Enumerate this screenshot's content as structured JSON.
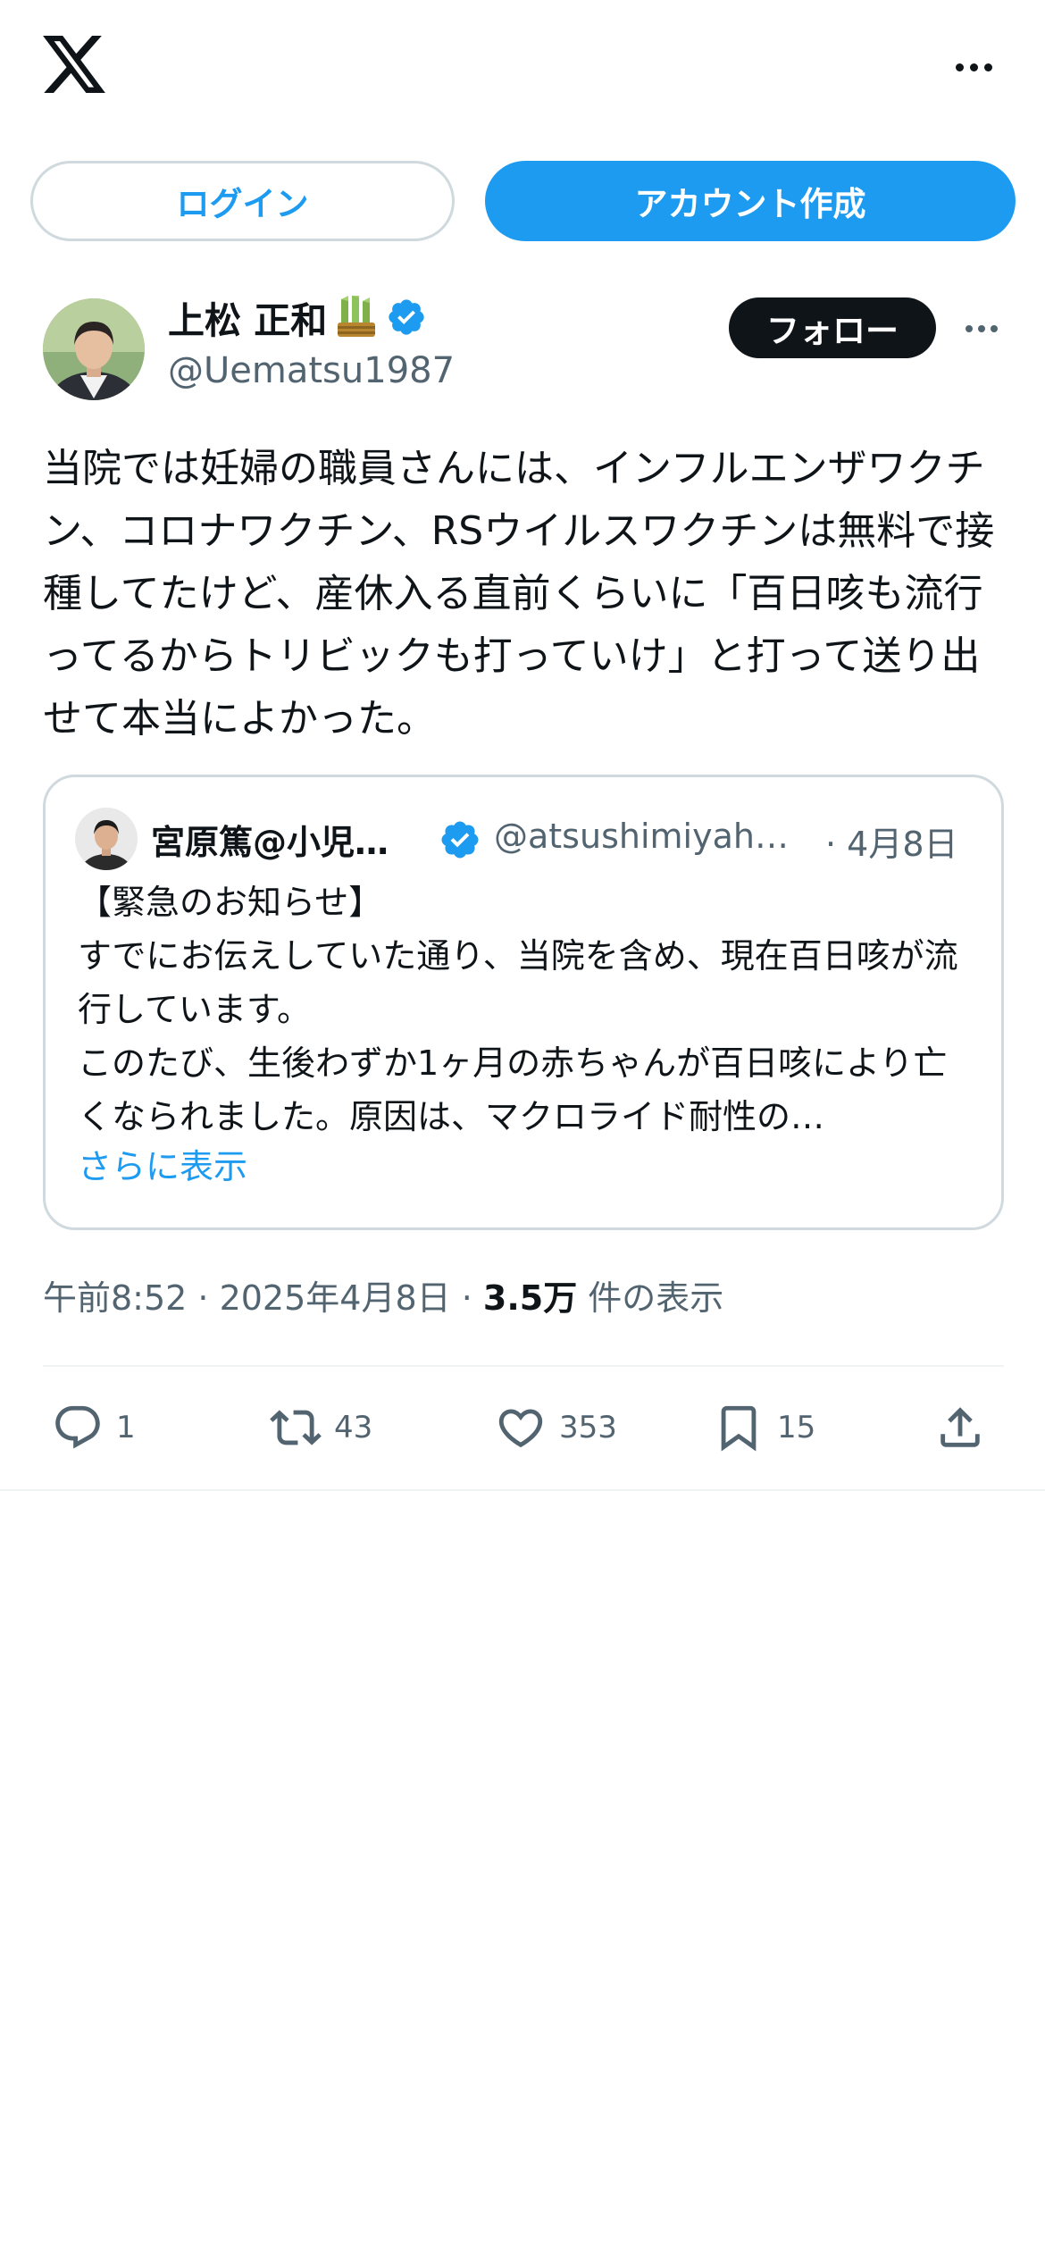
{
  "topbar": {
    "logo_icon": "x-logo-icon",
    "more_icon": "more-icon"
  },
  "auth": {
    "login_label": "ログイン",
    "signup_label": "アカウント作成"
  },
  "author": {
    "name": "上松 正和",
    "handle": "@Uematsu1987",
    "follow_label": "フォロー",
    "verified": true,
    "emoji_icon": "kadomatsu-icon"
  },
  "tweet": {
    "text": "当院では妊婦の職員さんには、インフルエンザワクチン、コロナワクチン、RSウイルスワクチンは無料で接種してたけど、産休入る直前くらいに「百日咳も流行ってるからトリビックも打っていけ」と打って送り出せて本当によかった。"
  },
  "quote": {
    "name": "宮原篤@小児…",
    "handle": "@atsushimiyah…",
    "date": "· 4月8日",
    "text": "【緊急のお知らせ】\nすでにお伝えしていた通り、当院を含め、現在百日咳が流行しています。\nこのたび、生後わずか1ヶ月の赤ちゃんが百日咳により亡くなられました。原因は、マクロライド耐性の…",
    "show_more": "さらに表示"
  },
  "meta": {
    "time_date": "午前8:52 · 2025年4月8日 · ",
    "views_count": "3.5万",
    "views_label": " 件の表示"
  },
  "actions": {
    "replies": "1",
    "retweets": "43",
    "likes": "353",
    "bookmarks": "15"
  },
  "colors": {
    "accent": "#1d9bf0",
    "text": "#0f1419",
    "muted": "#536471",
    "border": "#cfd9de"
  }
}
